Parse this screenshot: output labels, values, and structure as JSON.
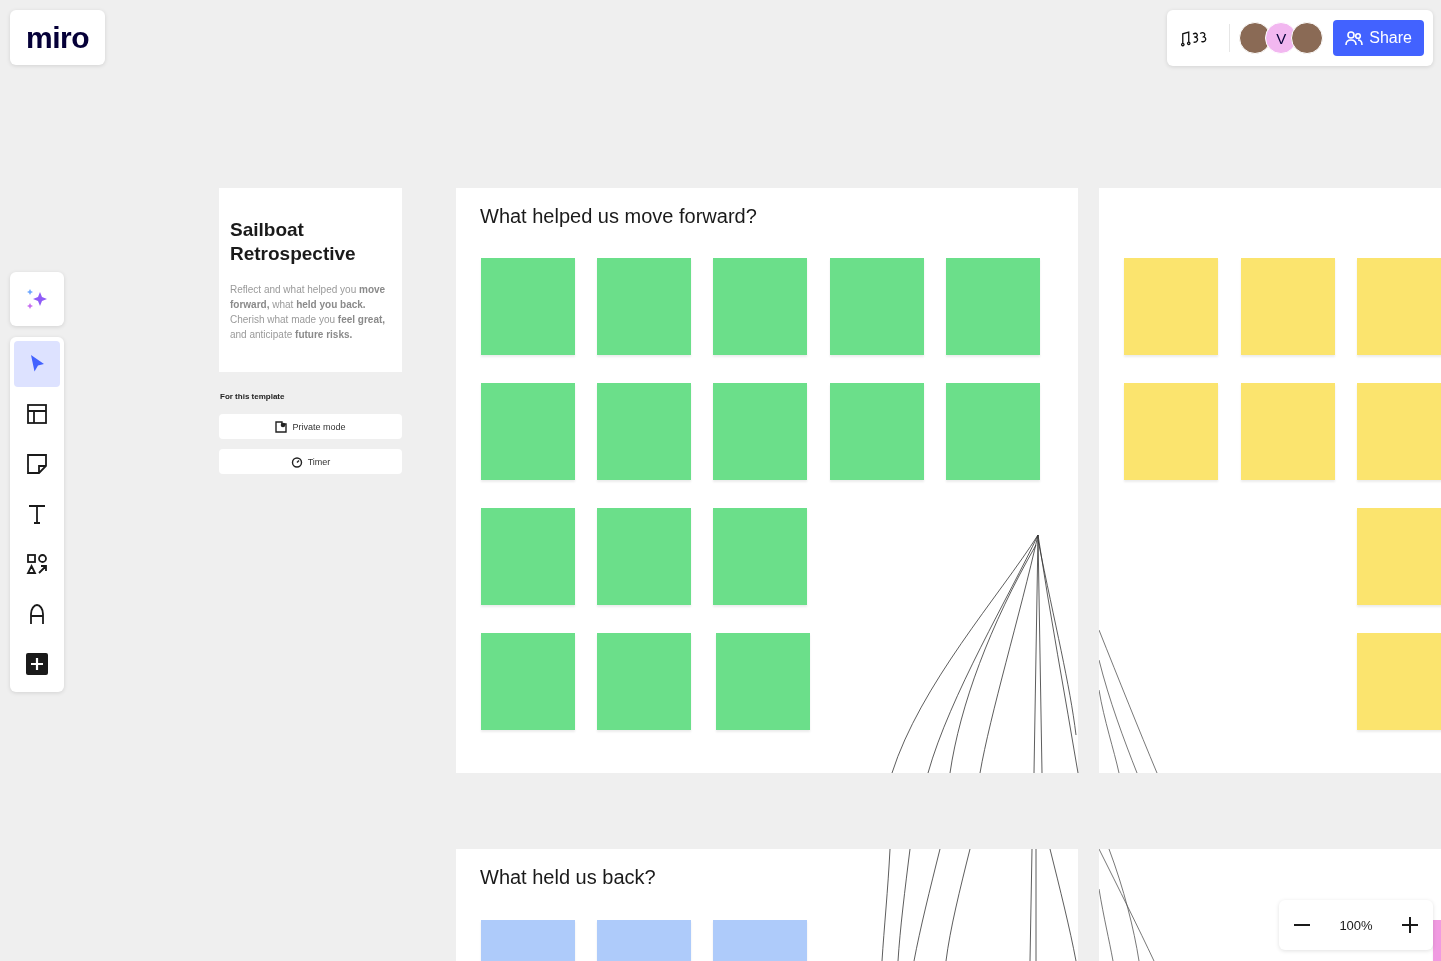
{
  "logo": "miro",
  "board_header": {
    "avatars": [
      {
        "kind": "photo"
      },
      {
        "kind": "letter",
        "initial": "V",
        "color": "#f2b7f0"
      },
      {
        "kind": "photo"
      }
    ],
    "share_label": "Share"
  },
  "tools": [
    {
      "kind": "select",
      "selected": true
    },
    {
      "kind": "templates",
      "selected": false
    },
    {
      "kind": "sticky",
      "selected": false
    },
    {
      "kind": "text",
      "selected": false
    },
    {
      "kind": "shapes",
      "selected": false
    },
    {
      "kind": "pen",
      "selected": false
    },
    {
      "kind": "more",
      "selected": false
    }
  ],
  "template_card": {
    "title": "Sailboat Retrospective",
    "description": "Reflect and what helped you **move forward,** what **held you back.** Cherish what made you **feel great,** and anticipate **future risks.**",
    "section_label": "For this template",
    "buttons": [
      {
        "kind": "private",
        "label": "Private mode"
      },
      {
        "kind": "timer",
        "label": "Timer"
      }
    ]
  },
  "frames": [
    {
      "title": "What helped us move forward?",
      "color": "#6bdf8a"
    },
    {
      "color": "#fbe46e"
    },
    {
      "title": "What held us back?",
      "color": "#aecbfa"
    },
    {
      "color": "#f09ae0"
    }
  ],
  "zoom": {
    "value": "100%"
  }
}
